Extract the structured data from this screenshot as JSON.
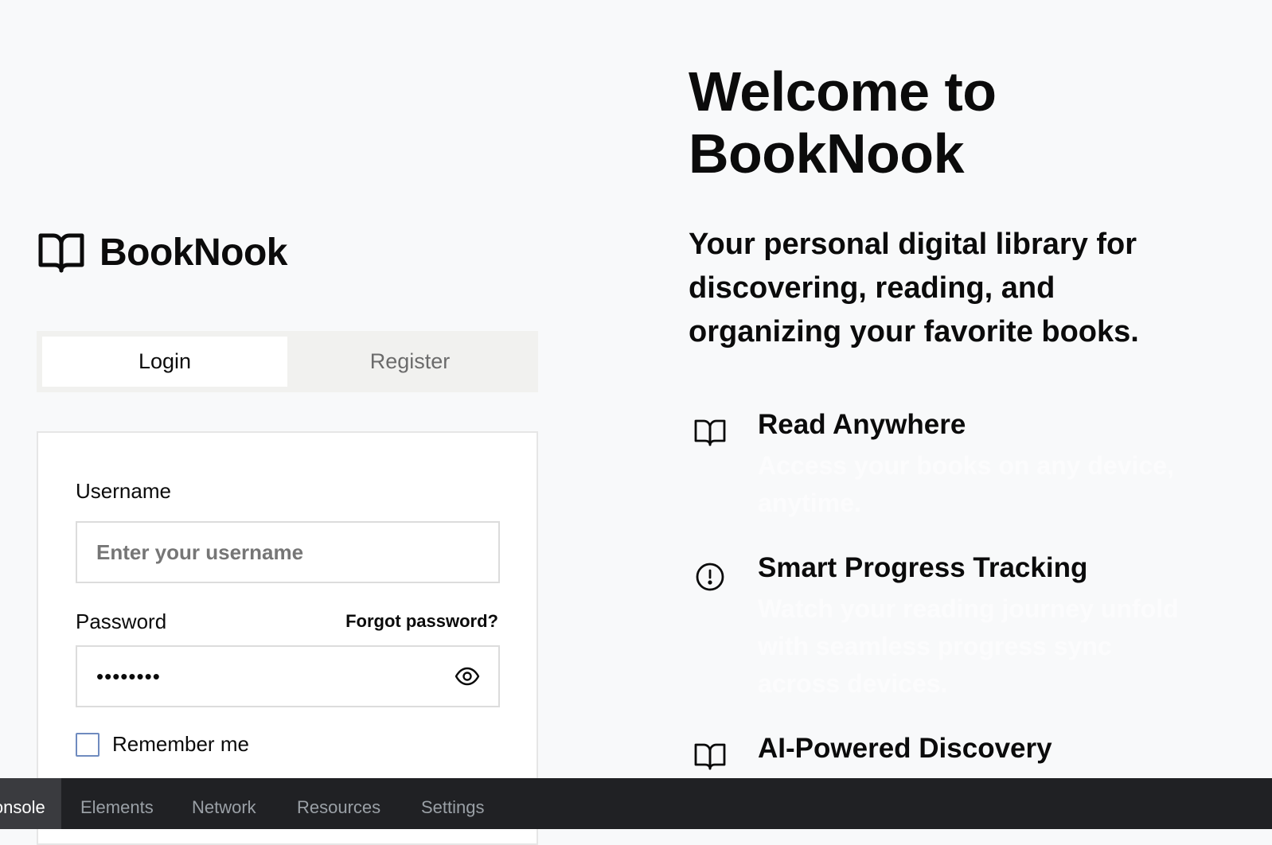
{
  "brand": {
    "name": "BookNook",
    "icon": "book-open-icon"
  },
  "auth_tabs": [
    {
      "label": "Login",
      "active": true
    },
    {
      "label": "Register",
      "active": false
    }
  ],
  "login_form": {
    "username_label": "Username",
    "username_placeholder": "Enter your username",
    "username_value": "",
    "password_label": "Password",
    "password_value": "••••••••",
    "forgot_password": "Forgot password?",
    "show_password_icon": "eye-icon",
    "remember_me_label": "Remember me",
    "remember_me_checked": false
  },
  "welcome": {
    "title": "Welcome to BookNook",
    "subtitle": "Your personal digital library for discovering, reading, and organizing your favorite books."
  },
  "features": [
    {
      "icon": "book-open-icon",
      "title": "Read Anywhere",
      "description": "Access your books on any device, anytime."
    },
    {
      "icon": "alert-circle-icon",
      "title": "Smart Progress Tracking",
      "description": "Watch your reading journey unfold with seamless progress sync across devices."
    },
    {
      "icon": "book-open-icon",
      "title": "AI-Powered Discovery",
      "description": ""
    }
  ],
  "devtools": {
    "tabs": [
      {
        "label": "Console",
        "active": true
      },
      {
        "label": "Elements",
        "active": false
      },
      {
        "label": "Network",
        "active": false
      },
      {
        "label": "Resources",
        "active": false
      },
      {
        "label": "Settings",
        "active": false
      }
    ]
  },
  "colors": {
    "page_background": "#f8f9fa",
    "text": "#0b0b0b",
    "muted_text": "#6b6b6b",
    "devtools_background": "#202124",
    "checkbox_border": "#6f8bbf"
  }
}
